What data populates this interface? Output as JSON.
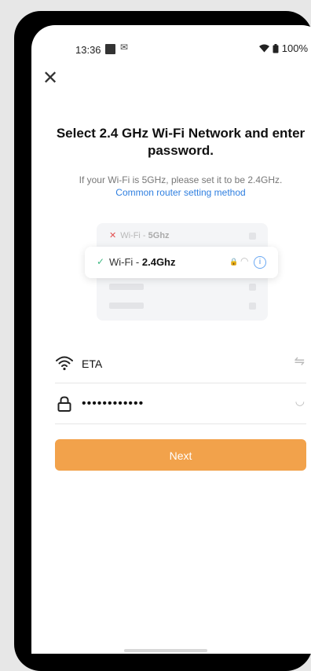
{
  "status_bar": {
    "time": "13:36",
    "battery": "100%"
  },
  "header": {
    "close_icon": "close-icon"
  },
  "title": "Select 2.4 GHz Wi-Fi Network and enter password.",
  "subtitle": "If your Wi-Fi is 5GHz, please set it to be 2.4GHz.",
  "router_link": "Common router setting method",
  "illustration": {
    "network_5g": {
      "prefix": "Wi-Fi - ",
      "band": "5Ghz"
    },
    "network_24g": {
      "prefix": "Wi-Fi - ",
      "band": "2.4Ghz"
    }
  },
  "form": {
    "ssid_value": "ETA",
    "password_value": "••••••••••••"
  },
  "next_button": "Next",
  "colors": {
    "accent": "#f2a24b",
    "link": "#2f7fe0",
    "check": "#3fb882"
  }
}
